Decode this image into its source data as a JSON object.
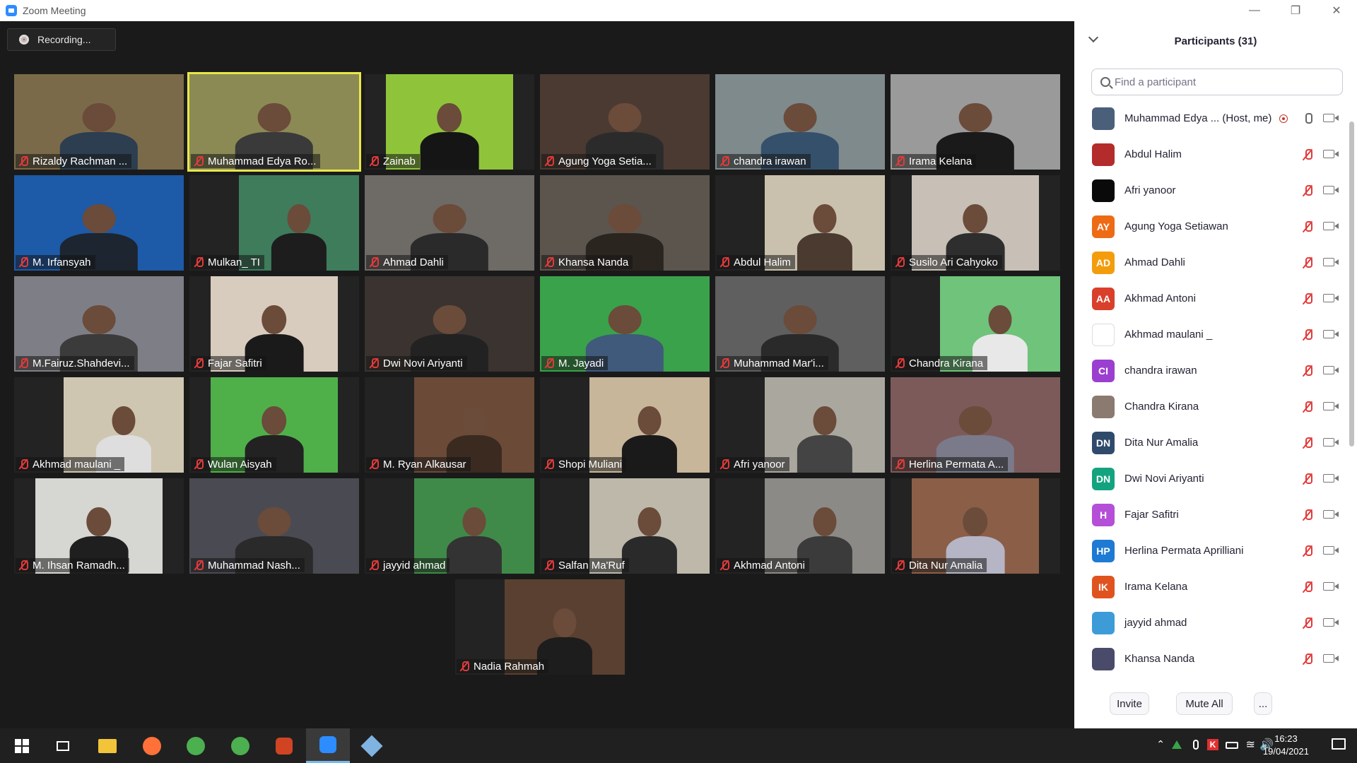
{
  "window": {
    "title": "Zoom Meeting"
  },
  "recording": {
    "label": "Recording..."
  },
  "tiles": [
    {
      "name": "Rizaldy Rachman ...",
      "bg": "#7a6a4a",
      "shirt": "#2c3e50",
      "active": false
    },
    {
      "name": "Muhammad Edya Ro...",
      "bg": "#8b8a55",
      "shirt": "#3a3a3a",
      "active": true
    },
    {
      "name": "Zainab",
      "bg": "#8fc43a",
      "shirt": "#151515",
      "active": false
    },
    {
      "name": "Agung Yoga Setia...",
      "bg": "#4a3a32",
      "shirt": "#2b2b2b",
      "active": false
    },
    {
      "name": "chandra irawan",
      "bg": "#7f8a8c",
      "shirt": "#35506b",
      "active": false
    },
    {
      "name": "Irama Kelana",
      "bg": "#9a9a9a",
      "shirt": "#1a1a1a",
      "active": false
    },
    {
      "name": "M. Irfansyah",
      "bg": "#1d5aa8",
      "shirt": "#1c2530",
      "active": false
    },
    {
      "name": "Mulkan_ TI",
      "bg": "#3e7c5c",
      "shirt": "#1d1d1d",
      "active": false
    },
    {
      "name": "Ahmad Dahli",
      "bg": "#6e6a66",
      "shirt": "#2a2a2a",
      "active": false
    },
    {
      "name": "Khansa Nanda",
      "bg": "#5c554e",
      "shirt": "#2b2520",
      "active": false
    },
    {
      "name": "Abdul Halim",
      "bg": "#c9c1ad",
      "shirt": "#4a3a30",
      "active": false
    },
    {
      "name": "Susilo Ari Cahyoko",
      "bg": "#c8bfb6",
      "shirt": "#2e2e2e",
      "active": false
    },
    {
      "name": "M.Fairuz.Shahdevi...",
      "bg": "#7e7e86",
      "shirt": "#3b3b3b",
      "active": false
    },
    {
      "name": "Fajar Safitri",
      "bg": "#d8ccbe",
      "shirt": "#1a1a1a",
      "active": false
    },
    {
      "name": "Dwi Novi Ariyanti",
      "bg": "#3a3330",
      "shirt": "#222",
      "active": false
    },
    {
      "name": "M. Jayadi",
      "bg": "#3aa24a",
      "shirt": "#3f5a7a",
      "active": false
    },
    {
      "name": "Muhammad Mar'i...",
      "bg": "#5f5f5f",
      "shirt": "#2a2a2a",
      "active": false
    },
    {
      "name": "Chandra Kirana",
      "bg": "#6fc37a",
      "shirt": "#e8e8e8",
      "active": false
    },
    {
      "name": "Akhmad maulani _",
      "bg": "#cfc6b2",
      "shirt": "#dedede",
      "active": false
    },
    {
      "name": "Wulan Aisyah",
      "bg": "#4fb04a",
      "shirt": "#222",
      "active": false
    },
    {
      "name": "M. Ryan Alkausar",
      "bg": "#6b4a38",
      "shirt": "#3a2a20",
      "active": false
    },
    {
      "name": "Shopi Muliani",
      "bg": "#c8b69a",
      "shirt": "#1a1a1a",
      "active": false
    },
    {
      "name": "Afri yanoor",
      "bg": "#aaa79f",
      "shirt": "#444",
      "active": false
    },
    {
      "name": "Herlina Permata A...",
      "bg": "#7d5a5a",
      "shirt": "#7a7a8a",
      "active": false
    },
    {
      "name": "M. Ihsan Ramadh...",
      "bg": "#d6d6d2",
      "shirt": "#1f1f1f",
      "active": false
    },
    {
      "name": "Muhammad Nash...",
      "bg": "#4a4a52",
      "shirt": "#2a2a2a",
      "active": false
    },
    {
      "name": "jayyid ahmad",
      "bg": "#3f8a48",
      "shirt": "#333",
      "active": false
    },
    {
      "name": "Salfan Ma'Ruf",
      "bg": "#bdb8aa",
      "shirt": "#2a2a2a",
      "active": false
    },
    {
      "name": "Akhmad Antoni",
      "bg": "#8c8a86",
      "shirt": "#3b3b3b",
      "active": false
    },
    {
      "name": "Dita Nur Amalia",
      "bg": "#8b5e48",
      "shirt": "#b5b5c5",
      "active": false
    },
    {
      "name": "Nadia Rahmah",
      "bg": "#5a4030",
      "shirt": "#1d1d1d",
      "active": false
    }
  ],
  "participants_panel": {
    "title": "Participants (31)",
    "search_placeholder": "Find a participant",
    "participants": [
      {
        "name": "Muhammad Edya ... (Host, me)",
        "initials": "",
        "color": "#4a5f7a",
        "mic": "on",
        "recording": true
      },
      {
        "name": "Abdul Halim",
        "initials": "",
        "color": "#b42b2b",
        "mic": "off",
        "recording": false
      },
      {
        "name": "Afri yanoor",
        "initials": "",
        "color": "#0a0a0a",
        "mic": "off",
        "recording": false
      },
      {
        "name": "Agung Yoga Setiawan",
        "initials": "AY",
        "color": "#ee6b16",
        "mic": "off",
        "recording": false
      },
      {
        "name": "Ahmad Dahli",
        "initials": "AD",
        "color": "#f49d0c",
        "mic": "off",
        "recording": false
      },
      {
        "name": "Akhmad Antoni",
        "initials": "AA",
        "color": "#d93f2a",
        "mic": "off",
        "recording": false
      },
      {
        "name": "Akhmad maulani _",
        "initials": "",
        "color": "#ffffff",
        "mic": "off",
        "recording": false
      },
      {
        "name": "chandra irawan",
        "initials": "CI",
        "color": "#9b3fd0",
        "mic": "off",
        "recording": false
      },
      {
        "name": "Chandra Kirana",
        "initials": "",
        "color": "#8a7a70",
        "mic": "off",
        "recording": false
      },
      {
        "name": "Dita Nur Amalia",
        "initials": "DN",
        "color": "#2f4a6b",
        "mic": "off",
        "recording": false
      },
      {
        "name": "Dwi Novi Ariyanti",
        "initials": "DN",
        "color": "#14a37f",
        "mic": "off",
        "recording": false
      },
      {
        "name": "Fajar Safitri",
        "initials": "H",
        "color": "#b54fd8",
        "mic": "off",
        "recording": false
      },
      {
        "name": "Herlina Permata Aprilliani",
        "initials": "HP",
        "color": "#1e7ad3",
        "mic": "off",
        "recording": false
      },
      {
        "name": "Irama Kelana",
        "initials": "IK",
        "color": "#e0531f",
        "mic": "off",
        "recording": false
      },
      {
        "name": "jayyid ahmad",
        "initials": "",
        "color": "#3d9bd8",
        "mic": "off",
        "recording": false
      },
      {
        "name": "Khansa Nanda",
        "initials": "",
        "color": "#4a4a6a",
        "mic": "off",
        "recording": false
      }
    ],
    "buttons": {
      "invite": "Invite",
      "mute_all": "Mute All",
      "more": "..."
    }
  },
  "taskbar": {
    "icons": [
      "windows-start-icon",
      "task-view-icon",
      "file-explorer-icon",
      "firefox-icon",
      "chrome-icon",
      "chrome-icon",
      "powerpoint-icon",
      "zoom-icon",
      "virtualbox-icon"
    ],
    "time": "16:23",
    "date": "19/04/2021"
  }
}
